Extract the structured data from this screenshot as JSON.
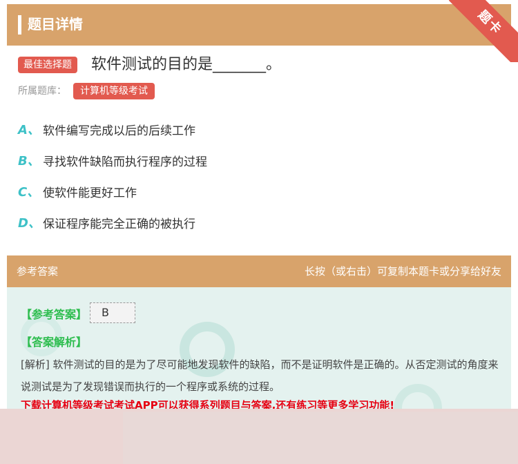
{
  "header": {
    "title": "题目详情"
  },
  "ribbon": {
    "text": "题卡"
  },
  "question": {
    "type_badge": "最佳选择题",
    "text": "软件测试的目的是_______。",
    "bank_label": "所属题库：",
    "bank_value": "计算机等级考试"
  },
  "options": [
    {
      "letter": "A、",
      "text": "软件编写完成以后的后续工作"
    },
    {
      "letter": "B、",
      "text": "寻找软件缺陷而执行程序的过程"
    },
    {
      "letter": "C、",
      "text": "使软件能更好工作"
    },
    {
      "letter": "D、",
      "text": "保证程序能完全正确的被执行"
    }
  ],
  "answer": {
    "head_left": "参考答案",
    "head_right": "长按（或右击）可复制本题卡或分享给好友",
    "ref_label": "【参考答案】",
    "ref_value": "B",
    "exp_label": "【答案解析】",
    "exp_text": "[解析] 软件测试的目的是为了尽可能地发现软件的缺陷，而不是证明软件是正确的。从否定测试的角度来说测试是为了发现错误而执行的一个程序或系统的过程。",
    "promo": "下载计算机等级考试考试APP可以获得系列题目与答案,还有练习等更多学习功能!"
  },
  "colors": {
    "header": "#d8a36b",
    "badge": "#e25a4f",
    "option_letter": "#3ec1c7",
    "answer_label": "#2ebd4f",
    "promo": "#e60012"
  }
}
